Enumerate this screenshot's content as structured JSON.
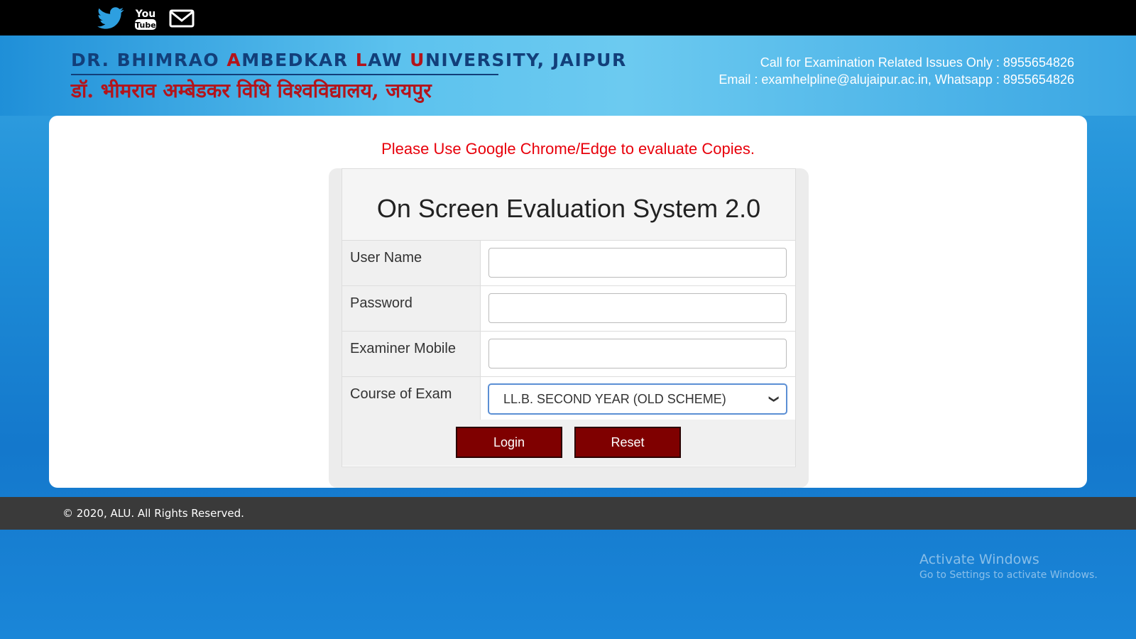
{
  "social": {
    "twitter": "twitter-icon",
    "youtube": "youtube-icon",
    "email": "mail-icon"
  },
  "header": {
    "university_en_parts": [
      "DR. BHIMRAO ",
      "A",
      "MBEDKAR ",
      "L",
      "AW ",
      "U",
      "NIVERSITY, JAIPUR"
    ],
    "university_hi": "डॉ. भीमराव अम्बेडकर विधि विश्वविद्यालय, जयपुर",
    "contact_line1": "Call for Examination Related Issues Only : 8955654826",
    "contact_line2": "Email : examhelpline@alujaipur.ac.in, Whatsapp : 8955654826"
  },
  "notice": "Please Use Google Chrome/Edge to evaluate Copies.",
  "form": {
    "title": "On Screen Evaluation System 2.0",
    "username_label": "User Name",
    "username_value": "",
    "password_label": "Password",
    "password_value": "",
    "mobile_label": "Examiner Mobile",
    "mobile_value": "",
    "course_label": "Course of Exam",
    "course_selected": "LL.B. SECOND YEAR (OLD SCHEME)",
    "login_label": "Login",
    "reset_label": "Reset"
  },
  "footer": {
    "copyright": "© 2020, ALU. All Rights Reserved."
  },
  "watermark": {
    "line1": "Activate Windows",
    "line2": "Go to Settings to activate Windows."
  },
  "colors": {
    "accent_red": "#e8000b",
    "button_bg": "#7f0000",
    "brand_blue": "#123f7a",
    "brand_red": "#b3141b"
  }
}
